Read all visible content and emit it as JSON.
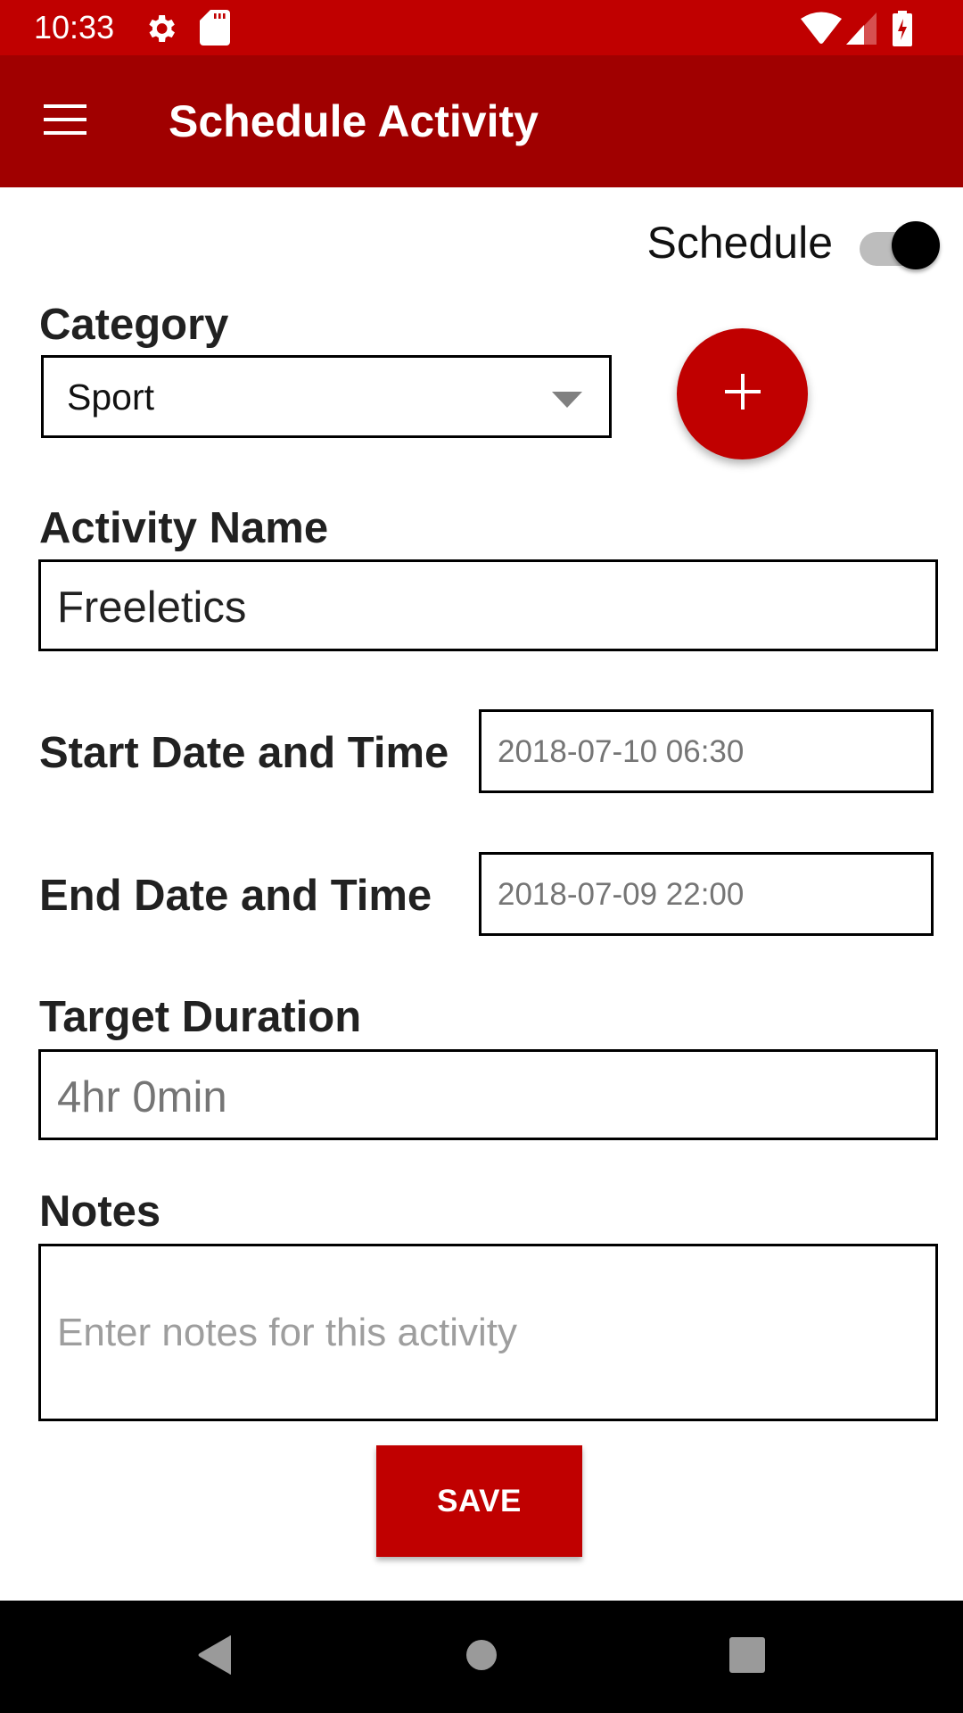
{
  "status_bar": {
    "time": "10:33",
    "icons": [
      "settings-gear-icon",
      "sd-card-icon",
      "wifi-icon",
      "cell-signal-icon",
      "battery-charging-icon"
    ]
  },
  "toolbar": {
    "menu_icon": "hamburger-menu-icon",
    "title": "Schedule Activity"
  },
  "schedule_toggle": {
    "label": "Schedule",
    "checked": true
  },
  "category": {
    "label": "Category",
    "selected": "Sport",
    "add_button_icon": "plus-icon"
  },
  "activity_name": {
    "label": "Activity Name",
    "value": "Freeletics"
  },
  "start_datetime": {
    "label": "Start Date and Time",
    "value": "2018-07-10 06:30"
  },
  "end_datetime": {
    "label": "End Date and Time",
    "value": "2018-07-09 22:00"
  },
  "target_duration": {
    "label": "Target Duration",
    "value": "4hr 0min"
  },
  "notes": {
    "label": "Notes",
    "placeholder": "Enter notes for this activity"
  },
  "save_button": {
    "label": "SAVE"
  },
  "nav_bar": {
    "buttons": [
      "back-icon",
      "home-icon",
      "recents-icon"
    ]
  },
  "colors": {
    "status_bar": "#C00000",
    "toolbar": "#A00000",
    "accent": "#C00000",
    "nav_bar": "#000000"
  }
}
